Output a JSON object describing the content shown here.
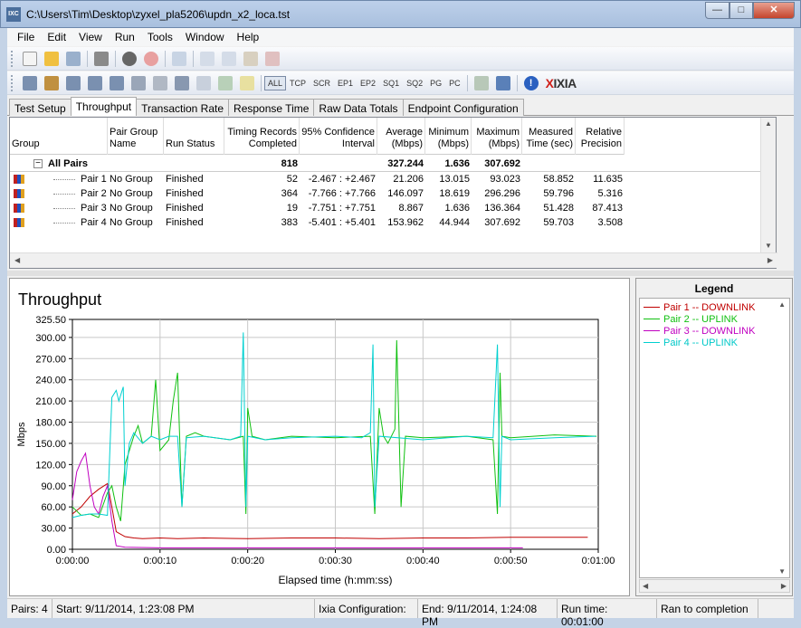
{
  "window": {
    "title": "C:\\Users\\Tim\\Desktop\\zyxel_pla5206\\updn_x2_loca.tst",
    "app_icon": "ixc-icon"
  },
  "menu": [
    "File",
    "Edit",
    "View",
    "Run",
    "Tools",
    "Window",
    "Help"
  ],
  "toolbar2_text": [
    "ALL",
    "TCP",
    "SCR",
    "EP1",
    "EP2",
    "SQ1",
    "SQ2",
    "PG",
    "PC"
  ],
  "brand": {
    "x": "X",
    "rest": "IXIA"
  },
  "tabs": [
    "Test Setup",
    "Throughput",
    "Transaction Rate",
    "Response Time",
    "Raw Data Totals",
    "Endpoint Configuration"
  ],
  "active_tab": 1,
  "grid": {
    "headers": [
      "Group",
      "Pair Group Name",
      "Run Status",
      "Timing Records Completed",
      "95% Confidence Interval",
      "Average (Mbps)",
      "Minimum (Mbps)",
      "Maximum (Mbps)",
      "Measured Time (sec)",
      "Relative Precision"
    ],
    "summary": {
      "expand": "−",
      "group": "All Pairs",
      "records": "818",
      "average": "327.244",
      "minimum": "1.636",
      "maximum": "307.692"
    },
    "rows": [
      {
        "pair": "Pair 1",
        "group_name": "No Group",
        "status": "Finished",
        "records": "52",
        "ci": "-2.467 : +2.467",
        "avg": "21.206",
        "min": "13.015",
        "max": "93.023",
        "time": "58.852",
        "precision": "11.635"
      },
      {
        "pair": "Pair 2",
        "group_name": "No Group",
        "status": "Finished",
        "records": "364",
        "ci": "-7.766 : +7.766",
        "avg": "146.097",
        "min": "18.619",
        "max": "296.296",
        "time": "59.796",
        "precision": "5.316"
      },
      {
        "pair": "Pair 3",
        "group_name": "No Group",
        "status": "Finished",
        "records": "19",
        "ci": "-7.751 : +7.751",
        "avg": "8.867",
        "min": "1.636",
        "max": "136.364",
        "time": "51.428",
        "precision": "87.413"
      },
      {
        "pair": "Pair 4",
        "group_name": "No Group",
        "status": "Finished",
        "records": "383",
        "ci": "-5.401 : +5.401",
        "avg": "153.962",
        "min": "44.944",
        "max": "307.692",
        "time": "59.703",
        "precision": "3.508"
      }
    ]
  },
  "legend": {
    "title": "Legend",
    "items": [
      {
        "label": "Pair 1 -- DOWNLINK",
        "color": "#c00000"
      },
      {
        "label": "Pair 2 -- UPLINK",
        "color": "#10c010"
      },
      {
        "label": "Pair 3 -- DOWNLINK",
        "color": "#c000c0"
      },
      {
        "label": "Pair 4 -- UPLINK",
        "color": "#00d0d0"
      }
    ]
  },
  "status": {
    "pairs": "Pairs: 4",
    "start": "Start: 9/11/2014, 1:23:08 PM",
    "config": "Ixia Configuration:",
    "end": "End: 9/11/2014, 1:24:08 PM",
    "runtime": "Run time: 00:01:00",
    "result": "Ran to completion"
  },
  "chart_data": {
    "type": "line",
    "title": "Throughput",
    "xlabel": "Elapsed time (h:mm:ss)",
    "ylabel": "Mbps",
    "xlim": [
      0,
      60
    ],
    "ylim": [
      0,
      325.5
    ],
    "xticks": [
      "0:00:00",
      "0:00:10",
      "0:00:20",
      "0:00:30",
      "0:00:40",
      "0:00:50",
      "0:01:00"
    ],
    "yticks": [
      "0.00",
      "30.00",
      "60.00",
      "90.00",
      "120.00",
      "150.00",
      "180.00",
      "210.00",
      "240.00",
      "270.00",
      "300.00",
      "325.50"
    ],
    "ytick_values": [
      0,
      30,
      60,
      90,
      120,
      150,
      180,
      210,
      240,
      270,
      300,
      325.5
    ],
    "grid": true,
    "legend_position": "right-pane",
    "series": [
      {
        "name": "Pair 1 -- DOWNLINK",
        "color": "#c00000",
        "x": [
          0,
          1,
          2,
          3,
          4,
          4.5,
          5,
          6,
          7,
          8,
          10,
          12,
          15,
          20,
          25,
          30,
          35,
          40,
          45,
          50,
          55,
          58.8
        ],
        "y": [
          50,
          60,
          75,
          85,
          93,
          60,
          25,
          18,
          16,
          15,
          16,
          15,
          16,
          15,
          16,
          16,
          15,
          16,
          16,
          17,
          17,
          17
        ]
      },
      {
        "name": "Pair 2 -- UPLINK",
        "color": "#10c010",
        "x": [
          0,
          1,
          2,
          3,
          4,
          4.5,
          5,
          5.5,
          6,
          7,
          7.5,
          8,
          9,
          9.5,
          10,
          11,
          11.5,
          12,
          12.5,
          13,
          14,
          15,
          18,
          19.5,
          19.8,
          20,
          20.5,
          22,
          25,
          30,
          34,
          34.5,
          35,
          35.5,
          36,
          36.8,
          37,
          37.5,
          38,
          40,
          45,
          48,
          48.5,
          48.8,
          49,
          50,
          55,
          59.8
        ],
        "y": [
          60,
          48,
          50,
          45,
          80,
          90,
          60,
          40,
          120,
          160,
          175,
          150,
          160,
          240,
          140,
          155,
          210,
          250,
          60,
          160,
          165,
          160,
          155,
          160,
          50,
          200,
          160,
          155,
          160,
          158,
          160,
          50,
          200,
          160,
          150,
          170,
          296,
          60,
          160,
          158,
          160,
          155,
          50,
          250,
          160,
          158,
          162,
          160
        ]
      },
      {
        "name": "Pair 3 -- DOWNLINK",
        "color": "#c000c0",
        "x": [
          0,
          0.5,
          1,
          1.5,
          2,
          2.5,
          3,
          3.5,
          4,
          4.5,
          5,
          6,
          10,
          20,
          30,
          40,
          51.4
        ],
        "y": [
          70,
          110,
          125,
          136,
          90,
          60,
          50,
          75,
          90,
          40,
          5,
          3,
          2,
          2,
          2,
          2,
          2
        ]
      },
      {
        "name": "Pair 4 -- UPLINK",
        "color": "#00d0d0",
        "x": [
          0,
          1,
          2,
          3,
          4,
          4.5,
          5,
          5.3,
          5.8,
          6,
          6.5,
          7,
          8,
          9,
          10,
          11,
          12,
          12.5,
          13,
          15,
          18,
          19.2,
          19.5,
          19.8,
          20,
          22,
          25,
          30,
          33,
          34,
          34.3,
          34.5,
          35,
          40,
          45,
          48,
          48.5,
          48.8,
          49,
          50,
          55,
          59.7
        ],
        "y": [
          45,
          48,
          50,
          50,
          48,
          215,
          225,
          210,
          230,
          90,
          150,
          165,
          150,
          160,
          155,
          160,
          160,
          60,
          158,
          160,
          155,
          160,
          307,
          60,
          160,
          155,
          158,
          160,
          158,
          165,
          290,
          60,
          160,
          155,
          160,
          158,
          290,
          60,
          160,
          155,
          158,
          160
        ]
      }
    ]
  }
}
